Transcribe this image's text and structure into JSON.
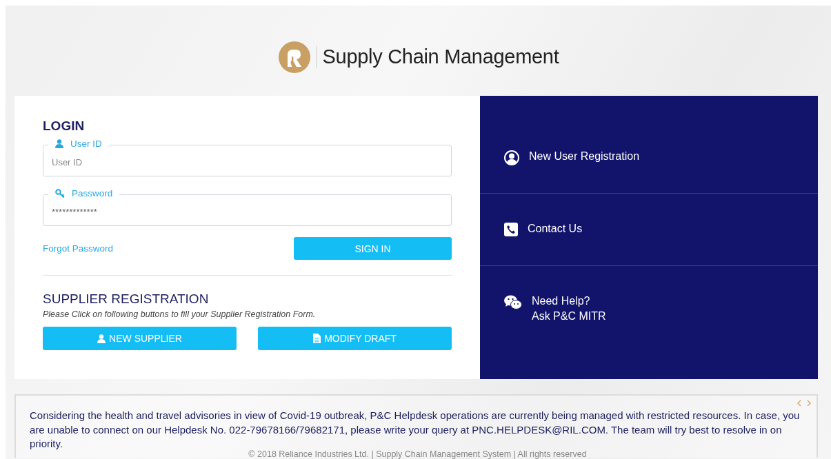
{
  "header": {
    "title": "Supply Chain Management"
  },
  "login": {
    "heading": "LOGIN",
    "fields": [
      {
        "kind": "user",
        "label": "User ID",
        "placeholder": "User ID"
      },
      {
        "kind": "password",
        "label": "Password",
        "value": "*************"
      }
    ],
    "forgot_link": "Forgot Password",
    "sign_in_button": "SIGN IN"
  },
  "supplier_registration": {
    "heading": "SUPPLIER REGISTRATION",
    "instruction": "Please Click on following buttons to fill your Supplier Registration Form.",
    "buttons": [
      {
        "kind": "new",
        "label": "NEW SUPPLIER"
      },
      {
        "kind": "modify",
        "label": "MODIFY DRAFT"
      }
    ]
  },
  "side_links": [
    {
      "kind": "user",
      "label": "New User Registration"
    },
    {
      "kind": "phone",
      "label": "Contact Us"
    },
    {
      "kind": "chat",
      "label": "Need Help?",
      "sublabel": "Ask P&C MITR"
    }
  ],
  "notice": {
    "text": "Considering the health and travel advisories in view of Covid-19 outbreak, P&C Helpdesk operations are currently being managed with restricted resources. In case, you are unable to connect on our Helpdesk No. 022-79678166/79682171, please write your query at PNC.HELPDESK@RIL.COM. The team will try best to resolve in on priority.",
    "footer": "© 2018 Reliance Industries Ltd. | Supply Chain Management System | All rights reserved"
  }
}
